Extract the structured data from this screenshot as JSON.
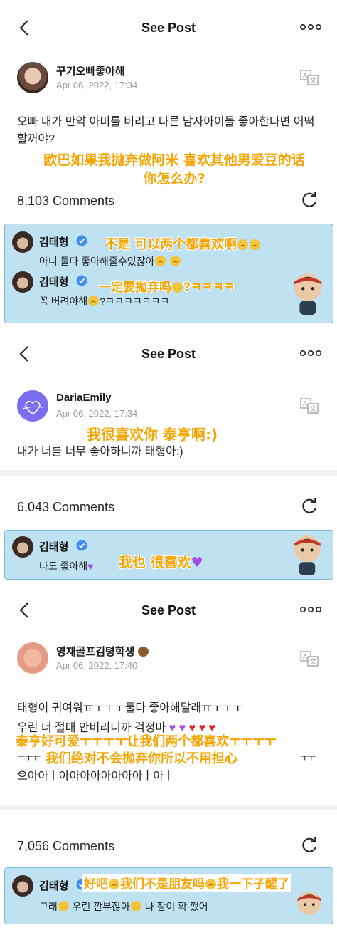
{
  "panels": [
    {
      "header": {
        "title": "See Post"
      },
      "post": {
        "author": "꾸기오빠좋아해",
        "date": "Apr 06, 2022, 17:34",
        "text": "오빠 내가 만약 아미를 버리고 다른 남자아이돌 좋아한다면 어떡할꺼야?",
        "translation": "欧巴如果我抛弃做阿米 喜欢其他男爱豆的话\n你怎么办?"
      },
      "comments_count": "8,103 Comments",
      "comments": [
        {
          "name": "김태형",
          "text": "아니 둘다 좋아해줄수있잖아",
          "translation": "不是 可以两个都喜欢啊"
        },
        {
          "name": "김태형",
          "text": "꼭 버려야해",
          "text_suffix": "?ㅋㅋㅋㅋㅋㅋㅋ",
          "translation": "一定要抛弃吗",
          "translation_suffix": "?ㅋㅋㅋㅋ"
        }
      ]
    },
    {
      "header": {
        "title": "See Post"
      },
      "post": {
        "author": "DariaEmily",
        "date": "Apr 06, 2022, 17:34",
        "text": "내가 너를 너무 좋아하니까 태형아:)",
        "translation": "我很喜欢你 泰亨啊:)"
      },
      "comments_count": "6,043 Comments",
      "comments": [
        {
          "name": "김태형",
          "text": "나도 좋아해",
          "translation": "我也 很喜欢"
        }
      ]
    },
    {
      "header": {
        "title": "See Post"
      },
      "post": {
        "author": "영재골프김텽학생",
        "date": "Apr 06, 2022, 17:40",
        "text_line1": "태형이 귀여워ㅠㅜㅜㅜ둘다 좋아해달래ㅠㅜㅜㅜ",
        "text_line2": "우린 너 절대 안버리니까 걱정마",
        "text_line3_prefix": "ㅜㅜㅠ",
        "text_line3_suffix": "ㅜㅠㅜ",
        "text_line4": "으아아ㅏ아아아아아아아아ㅏ아ㅏ",
        "translation_line1": "泰亨好可爱ㅜㅜㅜㅜ让我们两个都喜欢ㅜㅜㅜㅜ",
        "translation_line2": "我们绝对不会抛弃你所以不用担心"
      },
      "comments_count": "7,056 Comments",
      "comments": [
        {
          "name": "김태형",
          "text_a": "그래",
          "text_b": "우린 깐부잖아",
          "text_c": "나 잠이 확 깼어",
          "translation_a": "好吧",
          "translation_b": "我们不是朋友吗",
          "translation_c": "我一下子醒了"
        }
      ]
    }
  ],
  "colors": {
    "overlay": "#f6a400",
    "comment_bg": "#bfe2f2",
    "verified": "#3d8ef0"
  },
  "icons": [
    "back-icon",
    "more-icon",
    "translate-icon",
    "refresh-icon",
    "verified-icon",
    "emoji-icon",
    "heart-icon",
    "bear-icon"
  ]
}
